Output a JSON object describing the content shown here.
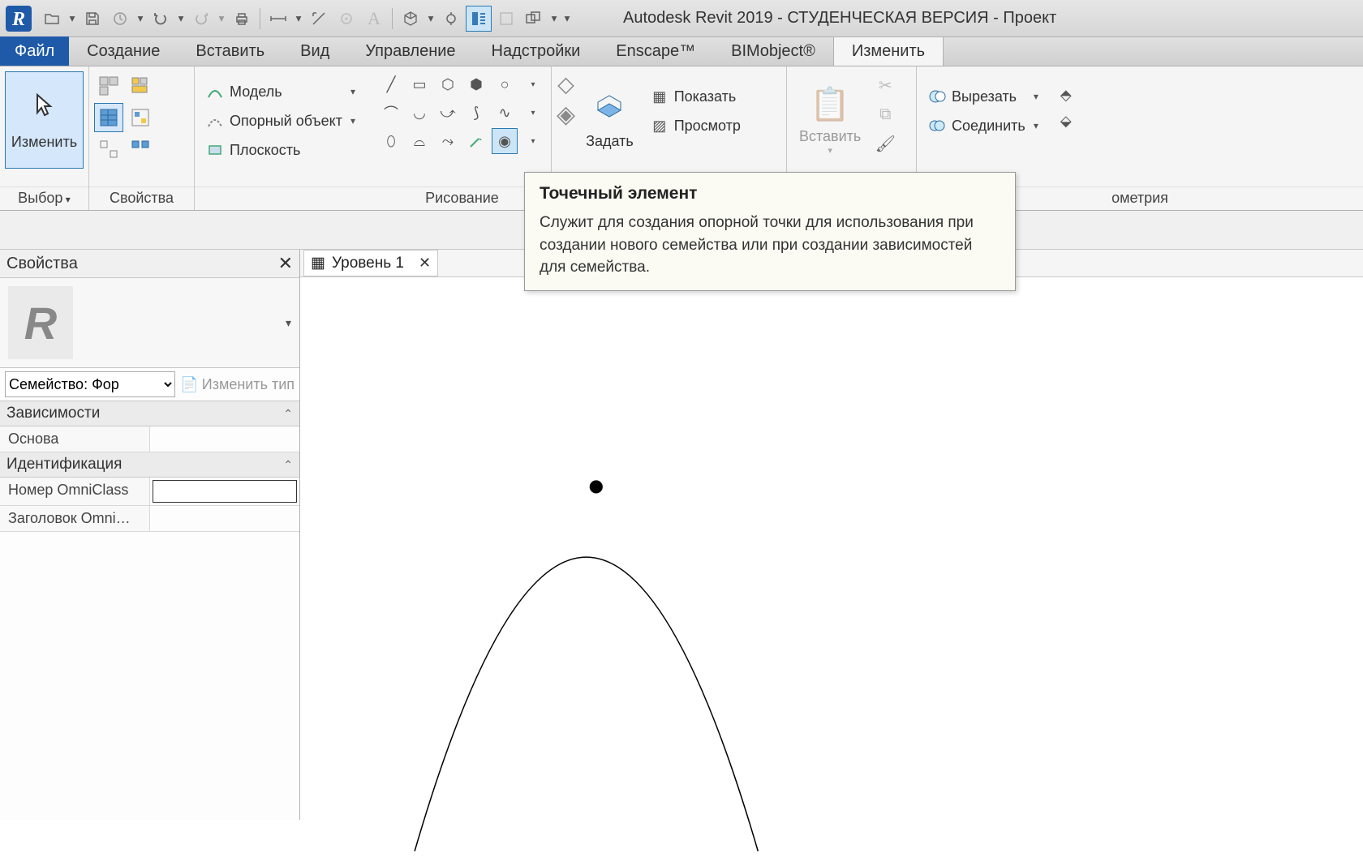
{
  "title": "Autodesk Revit 2019 - СТУДЕНЧЕСКАЯ ВЕРСИЯ - Проект",
  "file_tab": "Файл",
  "tabs": [
    "Создание",
    "Вставить",
    "Вид",
    "Управление",
    "Надстройки",
    "Enscape™",
    "BIMobject®",
    "Изменить"
  ],
  "active_tab_index": 7,
  "panels": {
    "select": {
      "label": "Выбор",
      "btn": "Изменить"
    },
    "properties": {
      "label": "Свойства"
    },
    "model_group": {
      "model": "Модель",
      "ref": "Опорный объект",
      "plane": "Плоскость"
    },
    "draw": {
      "label": "Рисование"
    },
    "workplane": {
      "set": "Задать",
      "show": "Показать",
      "viewer": "Просмотр"
    },
    "clipboard": {
      "paste": "Вставить"
    },
    "geometry": {
      "label": "ометрия",
      "cut": "Вырезать",
      "join": "Соединить"
    }
  },
  "tooltip": {
    "title": "Точечный элемент",
    "body": "Служит для создания опорной точки для использования при создании нового семейства или при создании зависимостей для семейства."
  },
  "properties_palette": {
    "title": "Свойства",
    "family": "Семейство: Фор",
    "edit_type": "Изменить тип",
    "groups": {
      "deps": {
        "label": "Зависимости",
        "rows": [
          {
            "k": "Основа",
            "v": ""
          }
        ]
      },
      "ident": {
        "label": "Идентификация",
        "rows": [
          {
            "k": "Номер OmniClass",
            "v": "",
            "editable": true
          },
          {
            "k": "Заголовок Omni…",
            "v": ""
          }
        ]
      }
    }
  },
  "view_tab": "Уровень 1"
}
